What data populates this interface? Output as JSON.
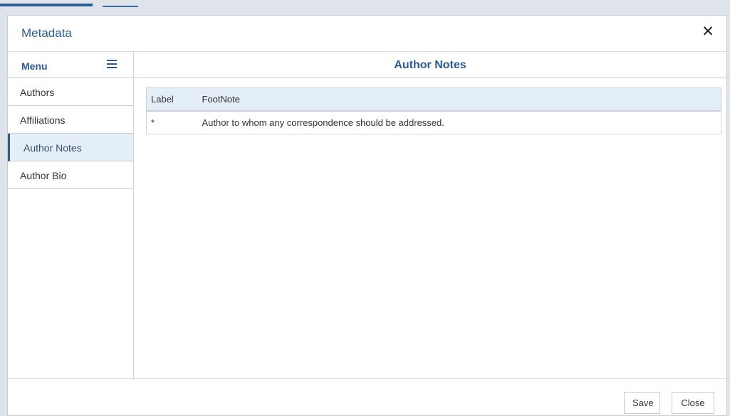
{
  "dialog": {
    "title": "Metadata",
    "close_glyph": "✕"
  },
  "sidebar": {
    "header": "Menu",
    "items": [
      {
        "label": "Authors",
        "active": false
      },
      {
        "label": "Affiliations",
        "active": false
      },
      {
        "label": "Author Notes",
        "active": true
      },
      {
        "label": "Author Bio",
        "active": false
      }
    ]
  },
  "content": {
    "title": "Author Notes",
    "table": {
      "headers": [
        "Label",
        "FootNote"
      ],
      "rows": [
        [
          "*",
          "Author to whom any correspondence should be addressed."
        ]
      ]
    }
  },
  "footer": {
    "save_label": "Save",
    "close_label": "Close"
  },
  "colors": {
    "accent": "#2d5b93",
    "active_bg": "#e3eef7"
  }
}
